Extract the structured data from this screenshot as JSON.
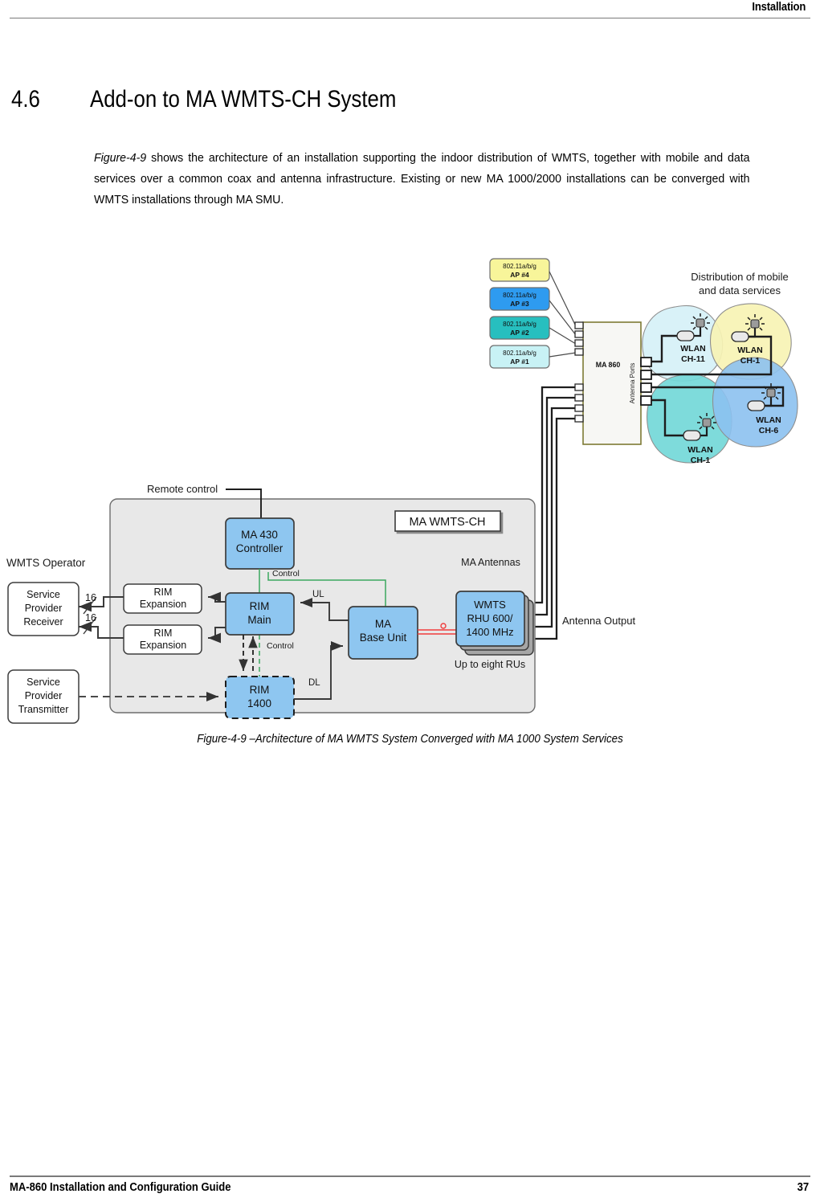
{
  "header": {
    "title": "Installation"
  },
  "section": {
    "number": "4.6",
    "title": "Add-on to MA WMTS-CH System"
  },
  "body": {
    "figure_ref": "Figure-4-9",
    "paragraph": " shows the architecture of an installation supporting the indoor distribution of WMTS, together with mobile and data services over a common coax and antenna infrastructure. Existing or new MA 1000/2000 installations can be converged with WMTS installations through MA SMU."
  },
  "caption": "Figure-4-9 –Architecture of MA WMTS System Converged with MA 1000 System Services",
  "footer": {
    "guide": "MA-860 Installation and Configuration Guide",
    "page": "37"
  },
  "diagram": {
    "title_box": "MA WMTS-CH",
    "hub": {
      "label": "MA 860",
      "ports_label": "Antenna Ports"
    },
    "distribution_note_line1": "Distribution of mobile",
    "distribution_note_line2": "and data services",
    "access_points": [
      {
        "std": "802.11a/b/g",
        "id": "AP #4",
        "color": "#f8f59a"
      },
      {
        "std": "802.11a/b/g",
        "id": "AP #3",
        "color": "#2e9bf0"
      },
      {
        "std": "802.11a/b/g",
        "id": "AP #2",
        "color": "#27bfbf"
      },
      {
        "std": "802.11a/b/g",
        "id": "AP #1",
        "color": "#c8f2f5"
      }
    ],
    "wlan_cells": [
      {
        "label1": "WLAN",
        "label2": "CH-11",
        "color": "#d6f2f7"
      },
      {
        "label1": "WLAN",
        "label2": "CH-1",
        "color": "#f6f2b0"
      },
      {
        "label1": "WLAN",
        "label2": "CH-1",
        "color": "#74d8d8"
      },
      {
        "label1": "WLAN",
        "label2": "CH-6",
        "color": "#8bc0ee"
      }
    ],
    "operator_label": "WMTS Operator",
    "service_provider_receiver": "Service\nProvider\nReceiver",
    "service_provider_receiver_lines": [
      "Service",
      "Provider",
      "Receiver"
    ],
    "service_provider_transmitter_lines": [
      "Service",
      "Provider",
      "Transmitter"
    ],
    "remote_control": "Remote control",
    "controller": {
      "line1": "MA 430",
      "line2": "Controller"
    },
    "rim_main": {
      "line1": "RIM",
      "line2": "Main"
    },
    "rim_1400": {
      "line1": "RIM",
      "line2": "1400"
    },
    "rim_expansion_1": {
      "line1": "RIM",
      "line2": "Expansion"
    },
    "rim_expansion_2": {
      "line1": "RIM",
      "line2": "Expansion"
    },
    "base_unit": {
      "line1": "MA",
      "line2": "Base Unit"
    },
    "rhu": {
      "line1": "WMTS",
      "line2": "RHU 600/",
      "line3": "1400 MHz"
    },
    "rhu_note": "Up to eight RUs",
    "ma_antennas_label": "MA Antennas",
    "antenna_output_label": "Antenna Output",
    "bus_labels": {
      "ul": "UL",
      "dl": "DL",
      "control_1": "Control",
      "control_2": "Control"
    },
    "fiber_counts": [
      "16",
      "16"
    ],
    "colors": {
      "block_blue": "#8ec6f0",
      "panel_gray": "#e8e8e8",
      "control_green": "#3aa85f",
      "fiber_red": "#f03c3c",
      "hub_border": "#7d7a34"
    }
  }
}
